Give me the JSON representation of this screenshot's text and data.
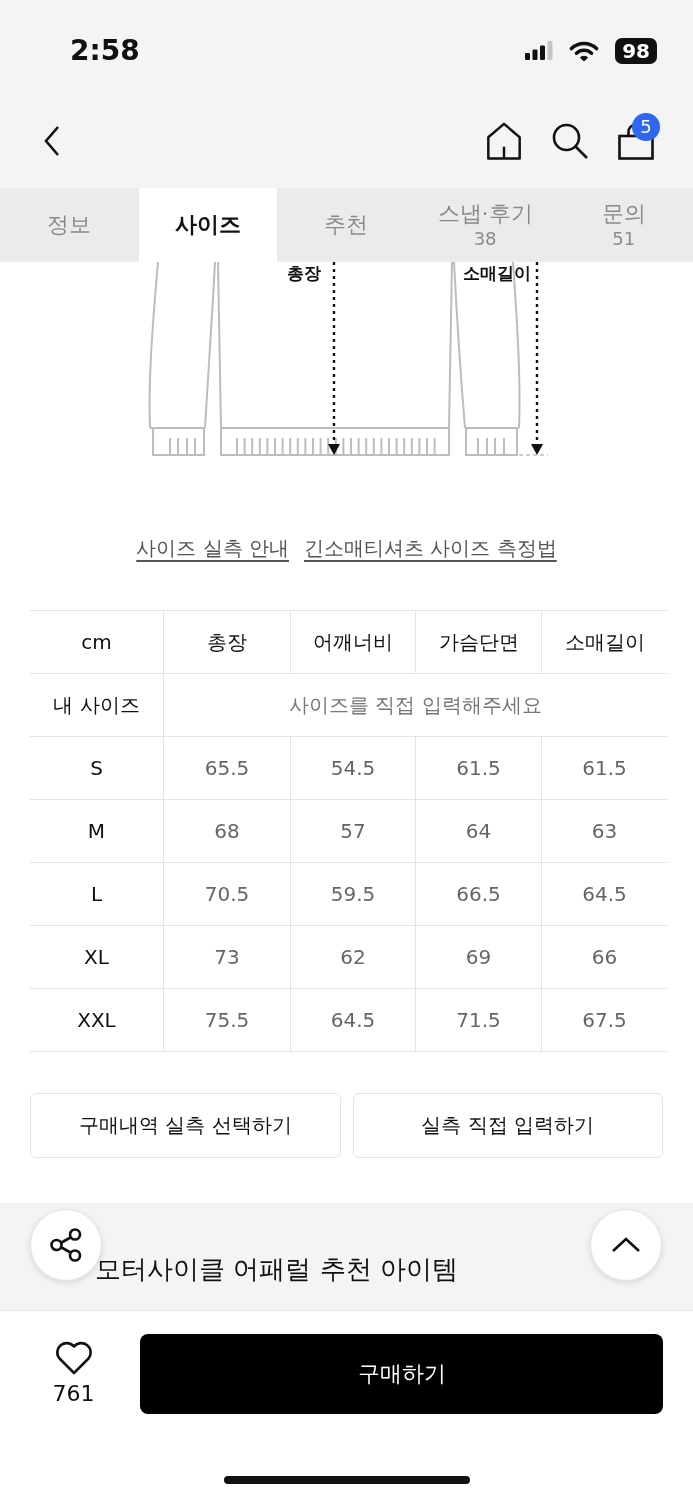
{
  "status_bar": {
    "time": "2:58",
    "battery": "98"
  },
  "nav": {
    "cart_count": "5"
  },
  "tabs": [
    {
      "label": "정보",
      "selected": false
    },
    {
      "label": "사이즈",
      "selected": true
    },
    {
      "label": "추천",
      "selected": false
    },
    {
      "label": "스냅·후기",
      "count": "38",
      "selected": false
    },
    {
      "label": "문의",
      "count": "51",
      "selected": false
    }
  ],
  "diagram": {
    "length_label": "총장",
    "sleeve_label": "소매길이"
  },
  "links": [
    "사이즈 실측 안내",
    "긴소매티셔츠 사이즈 측정법"
  ],
  "size_table": {
    "columns": [
      "cm",
      "총장",
      "어깨너비",
      "가슴단면",
      "소매길이"
    ],
    "my_size": {
      "label": "내 사이즈",
      "prompt": "사이즈를 직접 입력해주세요"
    },
    "rows": [
      [
        "S",
        "65.5",
        "54.5",
        "61.5",
        "61.5"
      ],
      [
        "M",
        "68",
        "57",
        "64",
        "63"
      ],
      [
        "L",
        "70.5",
        "59.5",
        "66.5",
        "64.5"
      ],
      [
        "XL",
        "73",
        "62",
        "69",
        "66"
      ],
      [
        "XXL",
        "75.5",
        "64.5",
        "71.5",
        "67.5"
      ]
    ]
  },
  "actions": [
    "구매내역 실측 선택하기",
    "실측 직접 입력하기"
  ],
  "recommend": {
    "title": "모터사이클 어패럴 추천 아이템"
  },
  "bottom_bar": {
    "liked": false,
    "likes": "761",
    "buy_label": "구매하기"
  }
}
